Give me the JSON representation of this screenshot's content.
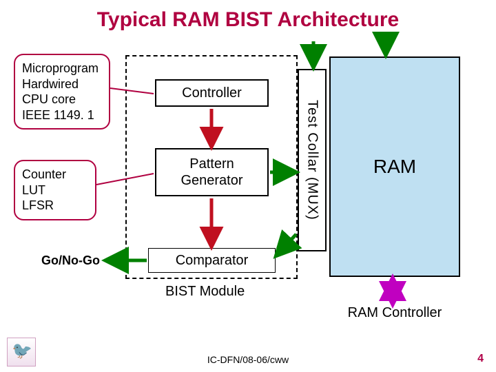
{
  "title": "Typical RAM BIST Architecture",
  "bist_module_label": "BIST Module",
  "blocks": {
    "controller": "Controller",
    "pattern_line1": "Pattern",
    "pattern_line2": "Generator",
    "comparator": "Comparator"
  },
  "collar_label": "Test Collar (MUX)",
  "ram_label": "RAM",
  "ram_controller_label": "RAM Controller",
  "callouts": {
    "controller_types": [
      "Microprogram",
      "Hardwired",
      "CPU core",
      "IEEE 1149. 1"
    ],
    "pattern_types": [
      "Counter",
      "LUT",
      "LFSR"
    ]
  },
  "go_nogo": "Go/No-Go",
  "footer": "IC-DFN/08-06/cww",
  "page_number": "4",
  "colors": {
    "accent": "#b00040",
    "ram_fill": "#bfe0f2",
    "arrow_red": "#c01020",
    "arrow_green": "#008000",
    "arrow_magenta": "#c000c0"
  }
}
